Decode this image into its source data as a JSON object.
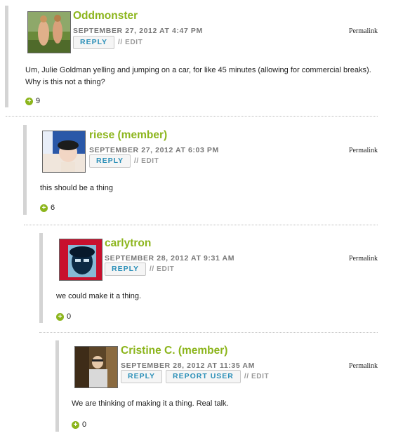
{
  "comments": [
    {
      "author": "Oddmonster",
      "date": "SEPTEMBER 27, 2012 AT 4:47 PM",
      "permalink": "Permalink",
      "reply": "REPLY",
      "edit": "// EDIT",
      "body": "Um, Julie Goldman yelling and jumping on a car, for like 45 minutes (allowing for commercial breaks). Why is this not a thing?",
      "votes": "9"
    },
    {
      "author": "riese (member)",
      "date": "SEPTEMBER 27, 2012 AT 6:03 PM",
      "permalink": "Permalink",
      "reply": "REPLY",
      "edit": "// EDIT",
      "body": "this should be a thing",
      "votes": "6"
    },
    {
      "author": "carlytron",
      "date": "SEPTEMBER 28, 2012 AT 9:31 AM",
      "permalink": "Permalink",
      "reply": "REPLY",
      "edit": "// EDIT",
      "body": "we could make it a thing.",
      "votes": "0"
    },
    {
      "author": "Cristine C. (member)",
      "date": "SEPTEMBER 28, 2012 AT 11:35 AM",
      "permalink": "Permalink",
      "reply": "REPLY",
      "report": "REPORT USER",
      "edit": "// EDIT",
      "body": "We are thinking of making it a thing. Real talk.",
      "votes": "0"
    }
  ],
  "icons": {
    "vote": "plus-circle-icon"
  },
  "colors": {
    "author": "#8cb51c",
    "reply": "#2a8fb8",
    "bar": "#d4d4d4"
  }
}
